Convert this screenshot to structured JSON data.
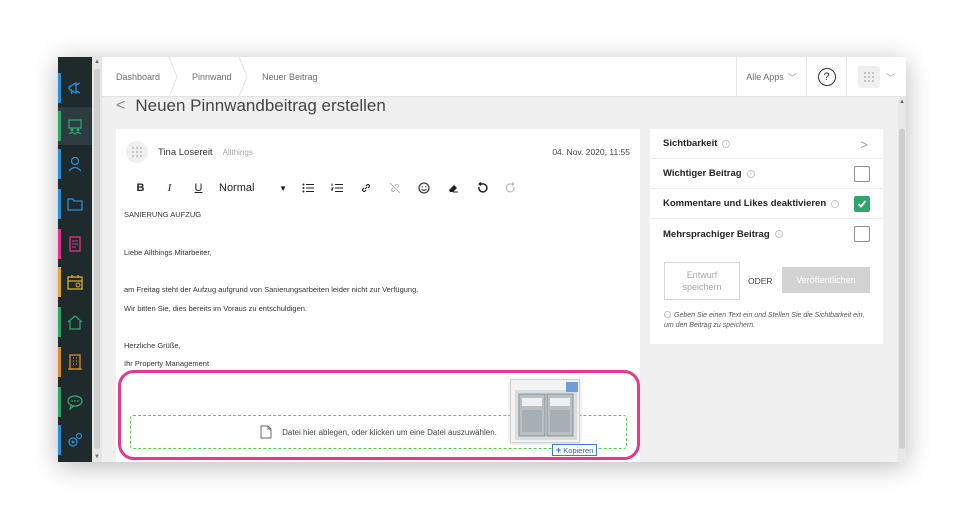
{
  "colors": {
    "nav_bg": "#1f2a2d",
    "accent_green": "#2ea66b",
    "highlight_pink": "#e5398e",
    "dropzone_green": "#4dd24d"
  },
  "nav": {
    "items": [
      {
        "icon": "megaphone-icon",
        "color": "#2b8fd6"
      },
      {
        "icon": "group-board-icon",
        "color": "#2ea66b",
        "active": true
      },
      {
        "icon": "user-icon",
        "color": "#2b8fd6"
      },
      {
        "icon": "folder-icon",
        "color": "#2b8fd6"
      },
      {
        "icon": "document-icon",
        "color": "#e0338a"
      },
      {
        "icon": "calendar-icon",
        "color": "#e0a82e"
      },
      {
        "icon": "home-icon",
        "color": "#2ea66b"
      },
      {
        "icon": "building-icon",
        "color": "#e08a2e"
      },
      {
        "icon": "chat-icon",
        "color": "#2ea66b"
      },
      {
        "icon": "settings-icon",
        "color": "#2b8fd6"
      }
    ]
  },
  "header": {
    "breadcrumbs": [
      "Dashboard",
      "Pinnwand",
      "Neuer Beitrag"
    ],
    "all_apps": "Alle Apps",
    "help": "?"
  },
  "page": {
    "title": "Neuen Pinnwandbeitrag erstellen"
  },
  "editor": {
    "author_name": "Tina Losereit",
    "author_org": "Allthings",
    "date": "04. Nov. 2020, 11:55",
    "toolbar": {
      "bold": "B",
      "italic": "I",
      "underline": "U",
      "format_select": "Normal"
    },
    "body": {
      "subject": "SANIERUNG AUFZUG",
      "greeting": "Liebe Allthings Mitarbeiter,",
      "line1": "am Freitag steht der Aufzug aufgrund von Sanierungsarbeiten leider nicht zur Verfügung.",
      "line2": "Wir bitten Sie, dies bereits im Voraus zu entschuldigen.",
      "closing": "Herzliche Grüße,",
      "signature": "Ihr Property Management"
    },
    "dropzone_text": "Datei hier ablegen, oder klicken um eine Datei auszuwählen.",
    "drag_copy_label": "Kopieren",
    "drag_copy_plus": "+"
  },
  "panel": {
    "visibility": "Sichtbarkeit",
    "important": "Wichtiger Beitrag",
    "important_checked": false,
    "disable_comments": "Kommentare und Likes deaktivieren",
    "disable_comments_checked": true,
    "multilingual": "Mehrsprachiger Beitrag",
    "multilingual_checked": false,
    "draft_button_line1": "Entwurf",
    "draft_button_line2": "speichern",
    "or": "ODER",
    "publish_button": "Veröffentlichen",
    "hint": "Geben Sie einen Text ein und Stellen Sie die Sichtbarkeit ein, um den Beitrag zu speichern."
  }
}
